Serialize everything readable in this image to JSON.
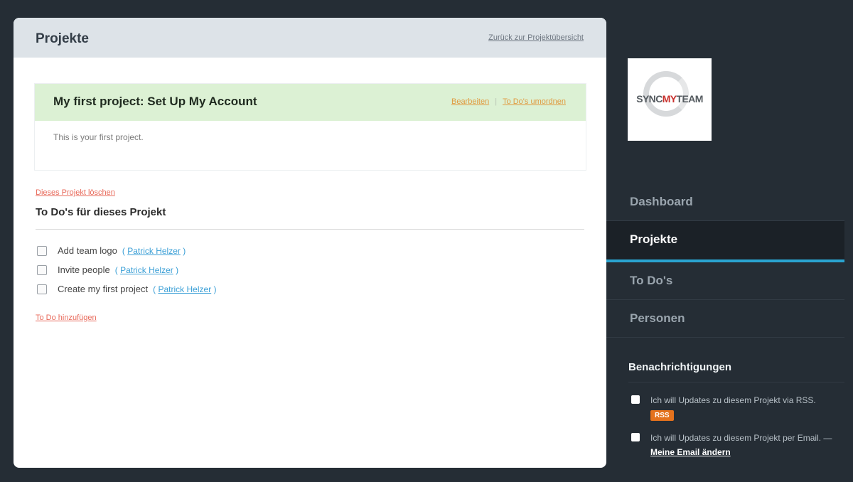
{
  "main": {
    "title": "Projekte",
    "back_link": "Zurück zur Projektübersicht",
    "project": {
      "title": "My first project: Set Up My Account",
      "edit_link": "Bearbeiten",
      "action_separator": "|",
      "hide_todos_link": "To Do's umordnen",
      "description": "This is your first project."
    },
    "delete_link": "Dieses Projekt löschen",
    "todos_heading": "To Do's für dieses Projekt",
    "todos": [
      {
        "text": "Add team logo",
        "assignee_open": "(",
        "assignee": "Patrick Helzer",
        "assignee_close": ")"
      },
      {
        "text": "Invite people",
        "assignee_open": "(",
        "assignee": "Patrick Helzer",
        "assignee_close": ")"
      },
      {
        "text": "Create my first project",
        "assignee_open": "(",
        "assignee": "Patrick Helzer",
        "assignee_close": ")"
      }
    ],
    "add_todo_link": "To Do hinzufügen"
  },
  "sidebar": {
    "logo": {
      "part1": "SYNC",
      "part2": "MY",
      "part3": "TEAM"
    },
    "nav": [
      {
        "label": "Dashboard"
      },
      {
        "label": "Projekte"
      },
      {
        "label": "To Do's"
      },
      {
        "label": "Personen"
      }
    ],
    "notifications": {
      "heading": "Benachrichtigungen",
      "rss_text": "Ich will Updates zu diesem Projekt via RSS.",
      "rss_badge": "RSS",
      "email_text": "Ich will Updates zu diesem Projekt per Email. —",
      "email_link": "Meine Email ändern"
    }
  },
  "colors": {
    "background": "#252d35",
    "project_header": "#dcf1d4",
    "accent": "#2aa4d0",
    "link_orange": "#e09a3f",
    "link_red": "#e86a5b",
    "link_blue": "#3a9fd6",
    "rss": "#e4721d"
  }
}
